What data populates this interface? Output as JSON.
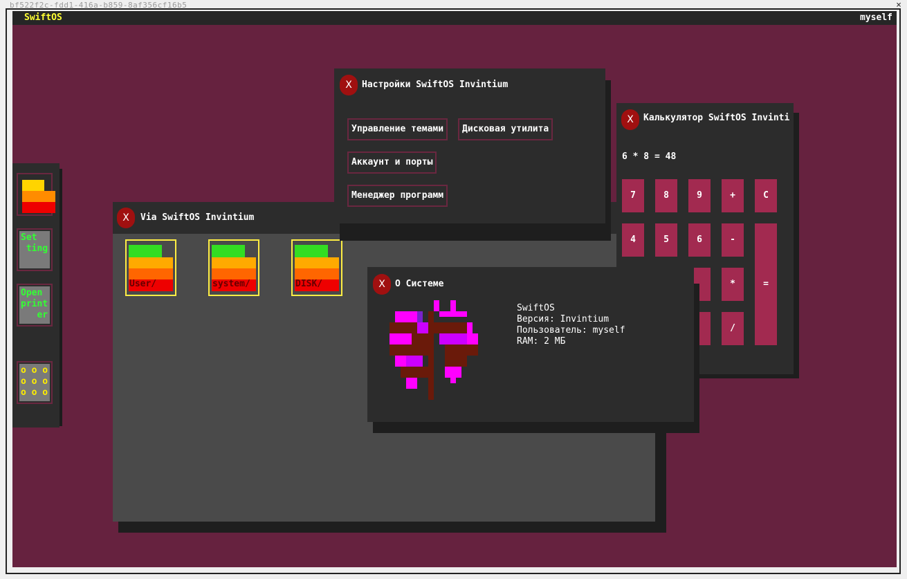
{
  "frame": {
    "title": "bf522f2c-fdd1-416a-b859-8af356cf16b5",
    "close": "×"
  },
  "topbar": {
    "os_name": "SwiftOS",
    "user": "myself"
  },
  "dock": {
    "items": [
      {
        "name": "files",
        "label": ""
      },
      {
        "name": "settings",
        "label_lines": [
          "Set",
          " ting"
        ]
      },
      {
        "name": "printer",
        "label_lines": [
          "Open",
          "print",
          "   er"
        ]
      },
      {
        "name": "apps",
        "label": "o o o\no o o\no o o"
      }
    ]
  },
  "windows": {
    "via": {
      "title": "Via SwiftOS Invintium",
      "close": "X",
      "folders": [
        "User/",
        "system/",
        "DISK/"
      ]
    },
    "settings": {
      "title": "Настройки SwiftOS Invintium",
      "close": "X",
      "buttons": [
        "Управление темами",
        "Дисковая утилита",
        "Аккаунт и порты",
        "Менеджер программ"
      ]
    },
    "calculator": {
      "title": "Калькулятор SwiftOS Invinti",
      "close": "X",
      "display": "6 * 8 = 48",
      "keys": [
        "7",
        "8",
        "9",
        "+",
        "C",
        "4",
        "5",
        "6",
        "-",
        "=",
        "*",
        "/"
      ]
    },
    "about": {
      "title": "О Системе",
      "close": "X",
      "os": "SwiftOS",
      "version": "Версия: Invintium",
      "user": "Пользователь: myself",
      "ram": "RAM: 2 МБ"
    }
  },
  "colors": {
    "desktop": "#66223f",
    "accent_yellow": "#ffff33",
    "close_red": "#a01010",
    "key_pink": "#a22a50"
  }
}
